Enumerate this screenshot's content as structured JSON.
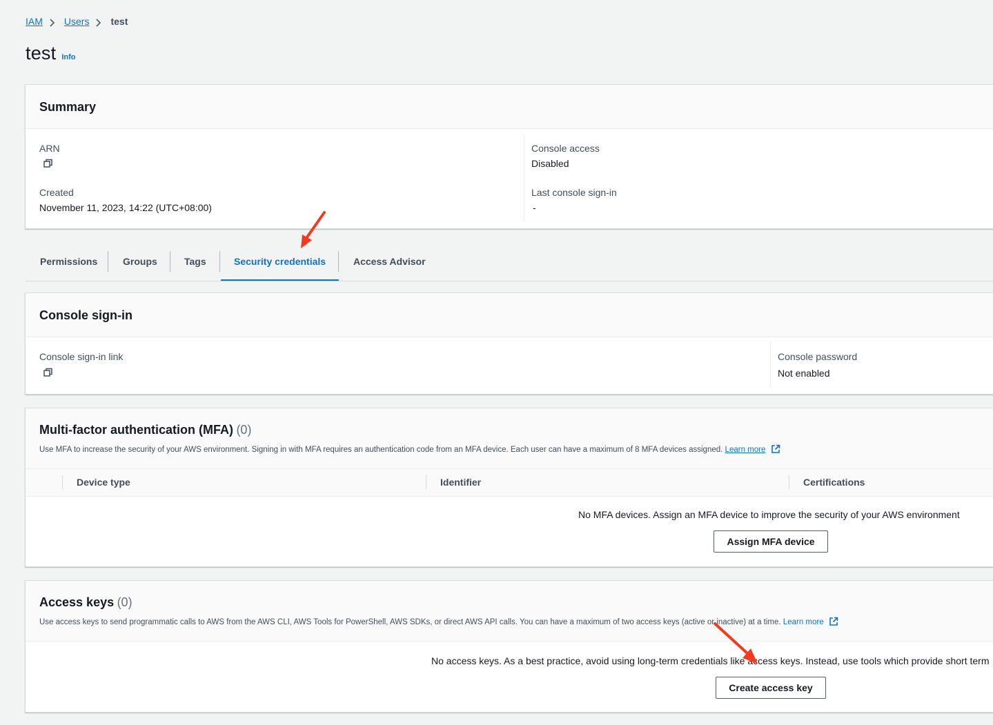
{
  "breadcrumb": {
    "items": [
      "IAM",
      "Users"
    ],
    "current": "test"
  },
  "page": {
    "title": "test",
    "info_label": "Info"
  },
  "summary": {
    "title": "Summary",
    "arn_label": "ARN",
    "created_label": "Created",
    "created_value": "November 11, 2023, 14:22 (UTC+08:00)",
    "console_access_label": "Console access",
    "console_access_value": "Disabled",
    "last_signin_label": "Last console sign-in",
    "last_signin_value": "-"
  },
  "tabs": [
    "Permissions",
    "Groups",
    "Tags",
    "Security credentials",
    "Access Advisor"
  ],
  "active_tab": "Security credentials",
  "console_signin": {
    "title": "Console sign-in",
    "link_label": "Console sign-in link",
    "password_label": "Console password",
    "password_value": "Not enabled"
  },
  "mfa": {
    "title": "Multi-factor authentication (MFA)",
    "count": "(0)",
    "description": "Use MFA to increase the security of your AWS environment. Signing in with MFA requires an authentication code from an MFA device. Each user can have a maximum of 8 MFA devices assigned.",
    "learn_more": "Learn more",
    "columns": [
      "Device type",
      "Identifier",
      "Certifications"
    ],
    "empty_text": "No MFA devices. Assign an MFA device to improve the security of your AWS environment",
    "button": "Assign MFA device"
  },
  "access_keys": {
    "title": "Access keys",
    "count": "(0)",
    "description": "Use access keys to send programmatic calls to AWS from the AWS CLI, AWS Tools for PowerShell, AWS SDKs, or direct AWS API calls. You can have a maximum of two access keys (active or inactive) at a time.",
    "learn_more": "Learn more",
    "empty_text": "No access keys. As a best practice, avoid using long-term credentials like access keys. Instead, use tools which provide short term",
    "button": "Create access key"
  },
  "colors": {
    "link": "#0972d3",
    "annotation_arrow": "#f5391f",
    "background": "#f2f3f3"
  }
}
